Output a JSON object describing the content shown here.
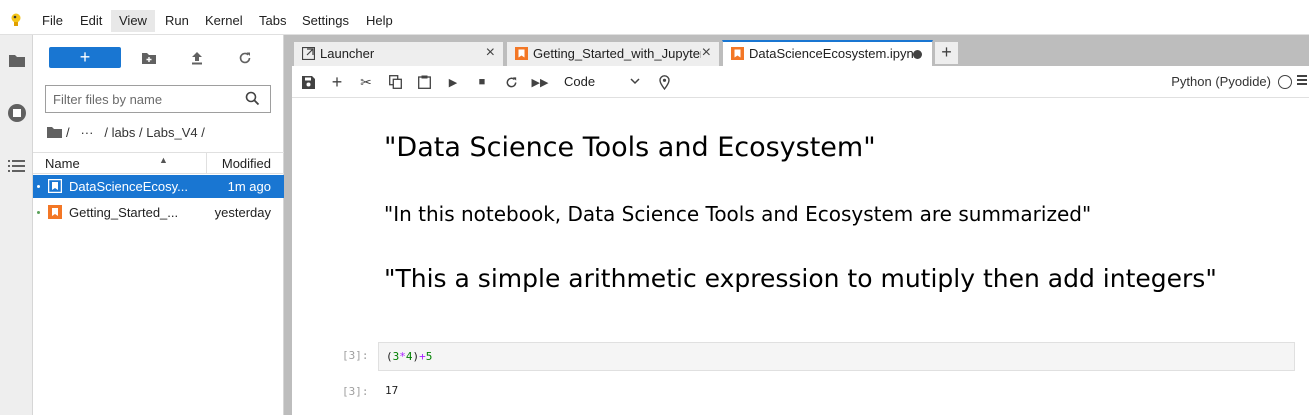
{
  "menubar": {
    "items": [
      "File",
      "Edit",
      "View",
      "Run",
      "Kernel",
      "Tabs",
      "Settings",
      "Help"
    ],
    "active": "View"
  },
  "filebrowser": {
    "new_label": "+",
    "filter_placeholder": "Filter files by name",
    "breadcrumbs": {
      "root": "/",
      "ellipsis": "···",
      "path1": "labs",
      "path2": "Labs_V4",
      "trail": "/"
    },
    "header": {
      "name": "Name",
      "modified": "Modified"
    },
    "files": [
      {
        "name": "DataScienceEcosy...",
        "modified": "1m ago",
        "selected": true
      },
      {
        "name": "Getting_Started_...",
        "modified": "yesterday",
        "selected": false
      }
    ]
  },
  "tabs": [
    {
      "label": "Launcher",
      "icon": "launcher-icon"
    },
    {
      "label": "Getting_Started_with_Jupyter",
      "icon": "notebook-icon"
    },
    {
      "label": "DataScienceEcosystem.ipynb",
      "icon": "notebook-icon",
      "active": true,
      "dirty": true
    }
  ],
  "toolbar": {
    "cell_type": "Code",
    "kernel": "Python (Pyodide)"
  },
  "notebook": {
    "h1": "\"Data Science Tools and Ecosystem\"",
    "h2": "\"In this notebook, Data Science Tools and Ecosystem are summarized\"",
    "h3": "\"This a simple arithmetic expression to mutiply then add integers\"",
    "input_prompt": "[3]:",
    "code": {
      "open": "(",
      "a": "3",
      "mul": "*",
      "b": "4",
      "close": ")",
      "add": "+",
      "c": "5"
    },
    "output_prompt": "[3]:",
    "output": "17"
  },
  "colors": {
    "accent": "#1976d2",
    "notebook_icon": "#f37726",
    "kernel_idle": "#424242"
  }
}
